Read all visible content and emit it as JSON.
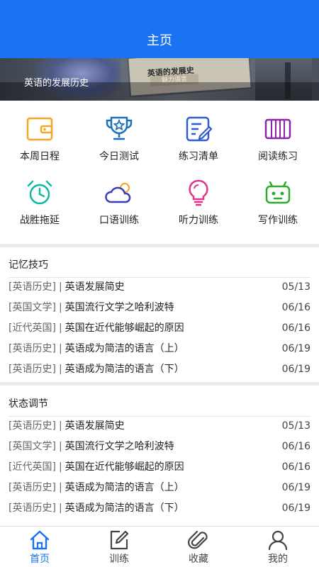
{
  "header": {
    "title": "主页"
  },
  "banner": {
    "caption": "英语的发展历史",
    "board_text": "英语的发展史",
    "tag_text": "魅力语言"
  },
  "shortcuts": [
    {
      "label": "本周日程",
      "icon": "wallet-icon",
      "color": "#f5a623"
    },
    {
      "label": "今日测试",
      "icon": "trophy-icon",
      "color": "#1d6fb8"
    },
    {
      "label": "练习清单",
      "icon": "edit-list-icon",
      "color": "#2f5bd6"
    },
    {
      "label": "阅读练习",
      "icon": "book-icon",
      "color": "#8e24aa"
    },
    {
      "label": "战胜拖延",
      "icon": "alarm-clock-icon",
      "color": "#14b8a6"
    },
    {
      "label": "口语训练",
      "icon": "cloud-sun-icon",
      "color": "#3a3fb5"
    },
    {
      "label": "听力训练",
      "icon": "lightbulb-icon",
      "color": "#e0338a"
    },
    {
      "label": "写作训练",
      "icon": "robot-icon",
      "color": "#2eaa2e"
    }
  ],
  "sections": [
    {
      "title": "记忆技巧",
      "items": [
        {
          "tag": "[英语历史]",
          "sep": "|",
          "title": "英语发展简史",
          "date": "05/13"
        },
        {
          "tag": "[英国文学]",
          "sep": "|",
          "title": "英国流行文学之哈利波特",
          "date": "06/16"
        },
        {
          "tag": "[近代英国]",
          "sep": "|",
          "title": "英国在近代能够崛起的原因",
          "date": "06/16"
        },
        {
          "tag": "[英语历史]",
          "sep": "|",
          "title": "英语成为简洁的语言（上）",
          "date": "06/19"
        },
        {
          "tag": "[英语历史]",
          "sep": "|",
          "title": "英语成为简洁的语言（下）",
          "date": "06/19"
        }
      ]
    },
    {
      "title": "状态调节",
      "items": [
        {
          "tag": "[英语历史]",
          "sep": "|",
          "title": "英语发展简史",
          "date": "05/13"
        },
        {
          "tag": "[英国文学]",
          "sep": "|",
          "title": "英国流行文学之哈利波特",
          "date": "06/16"
        },
        {
          "tag": "[近代英国]",
          "sep": "|",
          "title": "英国在近代能够崛起的原因",
          "date": "06/16"
        },
        {
          "tag": "[英语历史]",
          "sep": "|",
          "title": "英语成为简洁的语言（上）",
          "date": "06/19"
        },
        {
          "tag": "[英语历史]",
          "sep": "|",
          "title": "英语成为简洁的语言（下）",
          "date": "06/19"
        }
      ]
    }
  ],
  "tabbar": {
    "active_color": "#1a73f0",
    "tabs": [
      {
        "label": "首页",
        "icon": "home-icon",
        "active": true
      },
      {
        "label": "训练",
        "icon": "edit-icon",
        "active": false
      },
      {
        "label": "收藏",
        "icon": "paperclip-icon",
        "active": false
      },
      {
        "label": "我的",
        "icon": "user-icon",
        "active": false
      }
    ]
  }
}
